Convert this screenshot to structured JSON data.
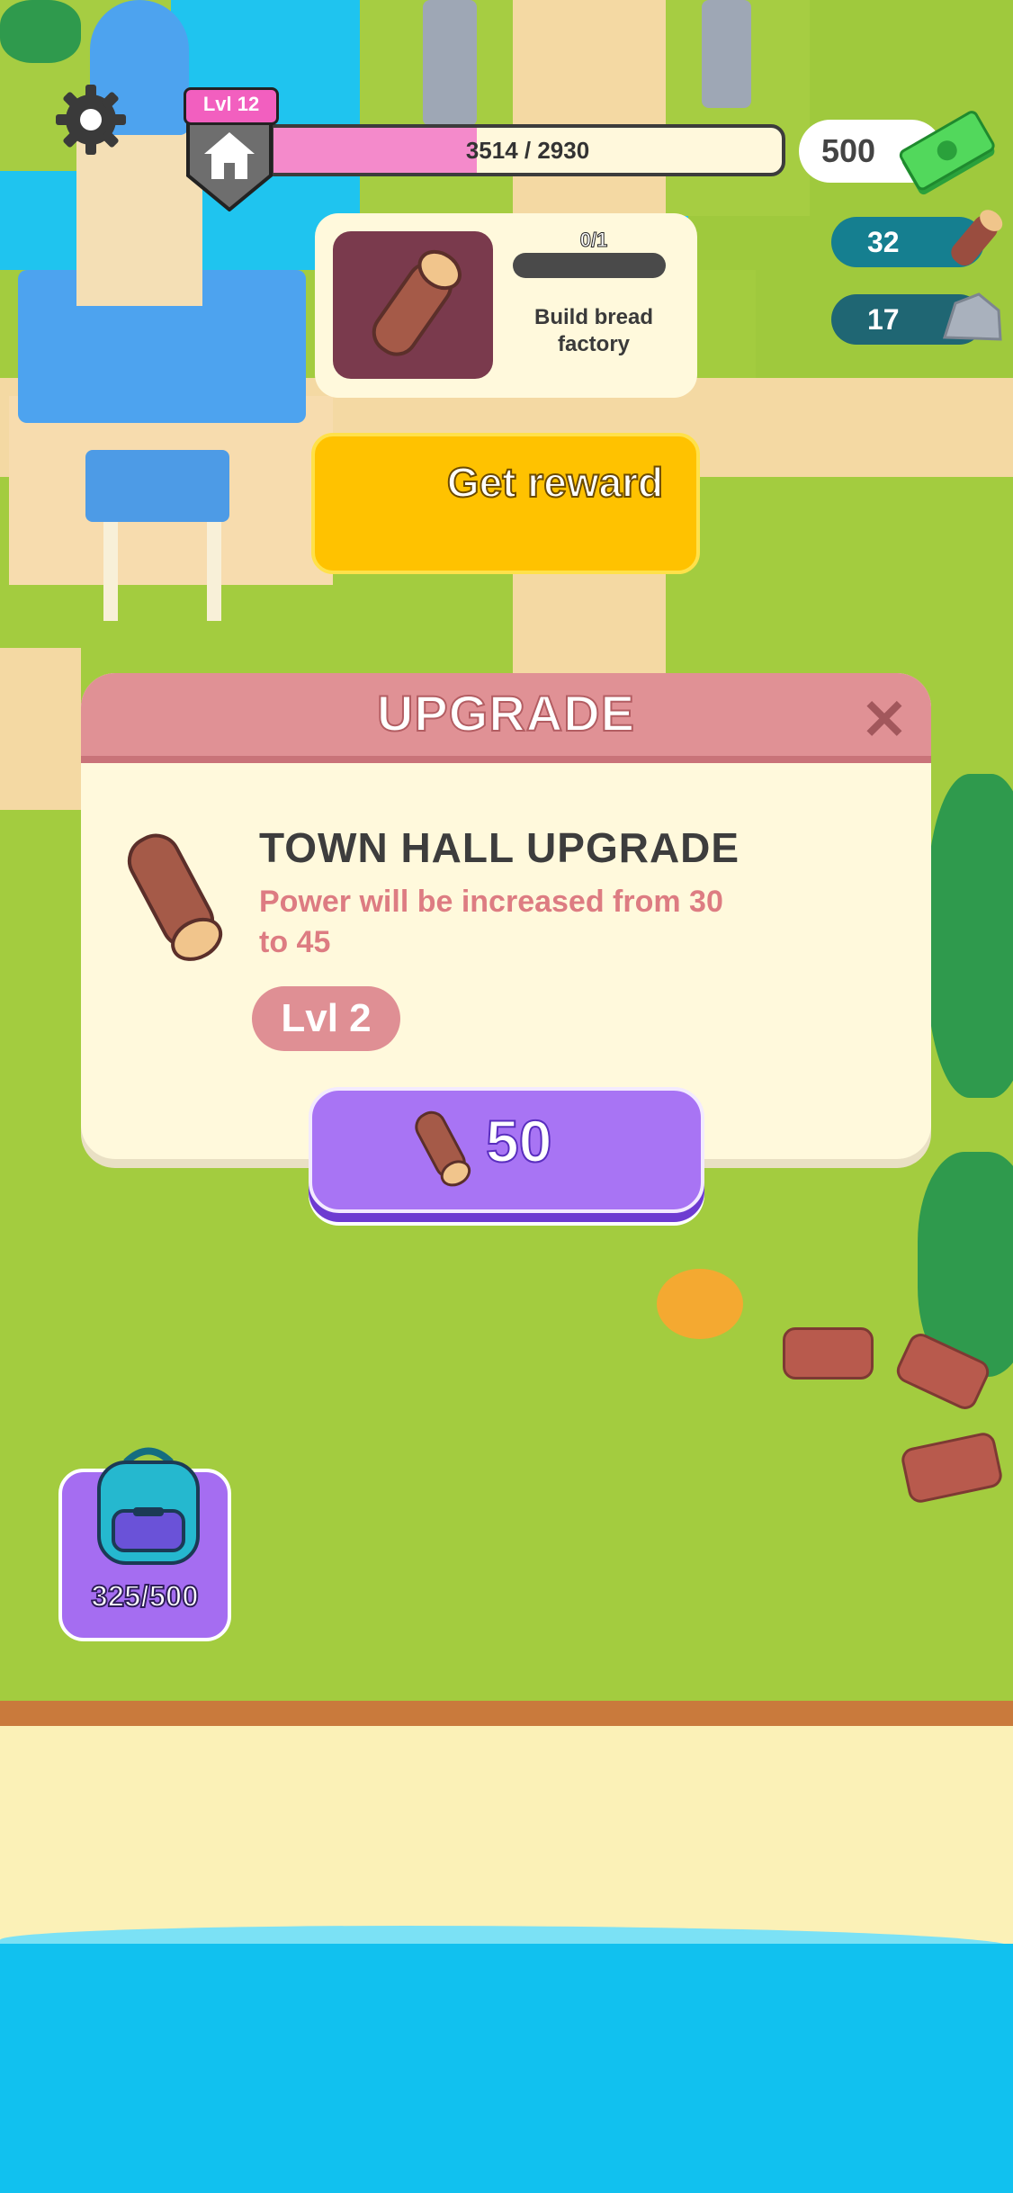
{
  "hud": {
    "level_tag": "Lvl 12",
    "xp_current": 3514,
    "xp_target": 2930,
    "xp_text": "3514 / 2930",
    "xp_fill_fraction": 0.4,
    "cash": "500",
    "wood": "32",
    "stone": "17"
  },
  "quest": {
    "progress": "0/1",
    "title": "Build bread factory",
    "reward_button": "Get reward"
  },
  "upgrade": {
    "header": "UPGRADE",
    "close": "✕",
    "item_name": "TOWN HALL UPGRADE",
    "description": "Power will be increased from 30 to 45",
    "level": "Lvl 2",
    "cost": "50"
  },
  "backpack": {
    "capacity": "325/500"
  },
  "colors": {
    "accent_pink": "#f48acb",
    "reward_yellow": "#ffc200",
    "buy_purple": "#a874f4",
    "modal_header": "#e09195"
  },
  "icons": {
    "settings": "gear-icon",
    "home": "house-icon",
    "cash": "banknote-icon",
    "wood": "log-icon",
    "stone": "rock-icon",
    "backpack": "backpack-icon"
  }
}
